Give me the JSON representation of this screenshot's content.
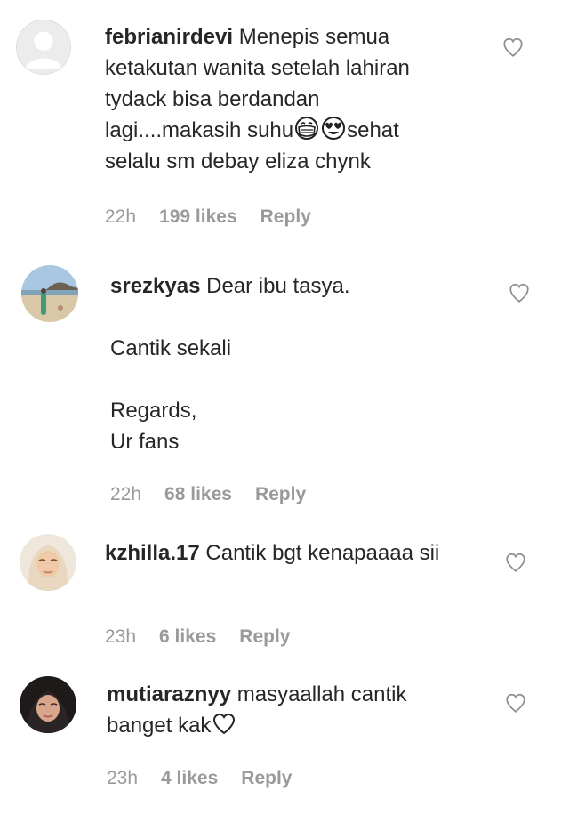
{
  "comments": [
    {
      "username": "febrianirdevi",
      "text_part1": " Menepis semua ketakutan wanita setelah lahiran tydack bisa berdandan lagi....makasih suhu",
      "text_part2": "sehat selalu sm debay eliza chynk",
      "emojis": [
        "face-with-medical-mask-icon",
        "smiling-face-with-heart-eyes-icon"
      ],
      "time": "22h",
      "likes": "199 likes",
      "reply": "Reply",
      "avatar": "default-avatar"
    },
    {
      "username": "srezkyas",
      "text": " Dear ibu tasya.\n\nCantik sekali\n\nRegards,\nUr fans",
      "time": "22h",
      "likes": "68 likes",
      "reply": "Reply",
      "avatar": "beach-photo-avatar"
    },
    {
      "username": "kzhilla.17",
      "text": " Cantik bgt kenapaaaa sii",
      "time": "23h",
      "likes": "6 likes",
      "reply": "Reply",
      "avatar": "hijab-photo-avatar"
    },
    {
      "username": "mutiaraznyy",
      "text": " masyaallah cantik banget kak",
      "time": "23h",
      "likes": "4 likes",
      "reply": "Reply",
      "avatar": "portrait-photo-avatar"
    }
  ],
  "colors": {
    "text": "#262626",
    "meta": "#9a9a9a",
    "heart": "#8e8e8e",
    "separator": "#e9e9e9"
  }
}
